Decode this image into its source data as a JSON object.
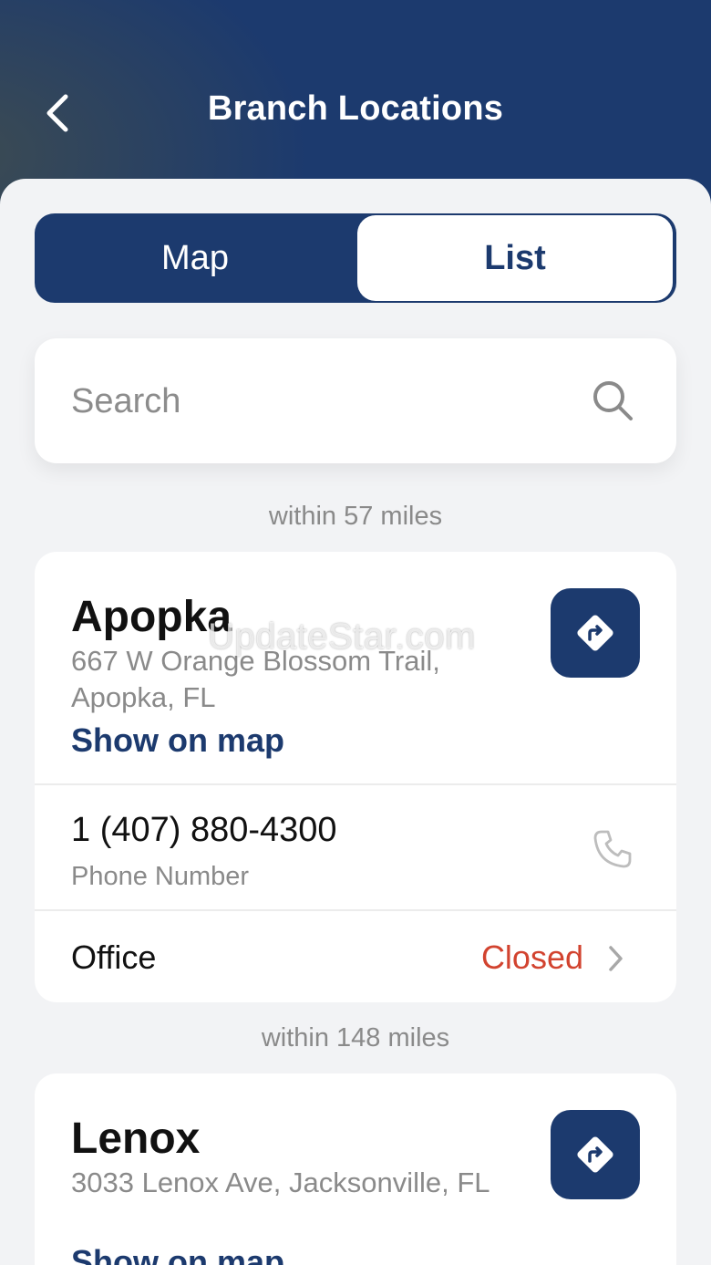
{
  "header": {
    "title": "Branch Locations",
    "back_icon": "chevron-left-icon"
  },
  "tabs": [
    {
      "label": "Map",
      "selected": false
    },
    {
      "label": "List",
      "selected": true
    }
  ],
  "search": {
    "placeholder": "Search",
    "icon": "search-icon"
  },
  "branches": [
    {
      "distance": "within 57 miles",
      "name": "Apopka",
      "address": "667 W Orange Blossom Trail, Apopka, FL",
      "show_on_map": "Show on map",
      "phone": "1 (407) 880-4300",
      "phone_label": "Phone Number",
      "office_label": "Office",
      "office_status": "Closed"
    },
    {
      "distance": "within 148 miles",
      "name": "Lenox",
      "address": "3033 Lenox Ave, Jacksonville, FL",
      "show_on_map": "Show on map"
    }
  ],
  "watermark": "UpdateStar.com",
  "colors": {
    "primary": "#1c3a6e",
    "closed": "#d2432f",
    "background": "#f2f3f5"
  }
}
